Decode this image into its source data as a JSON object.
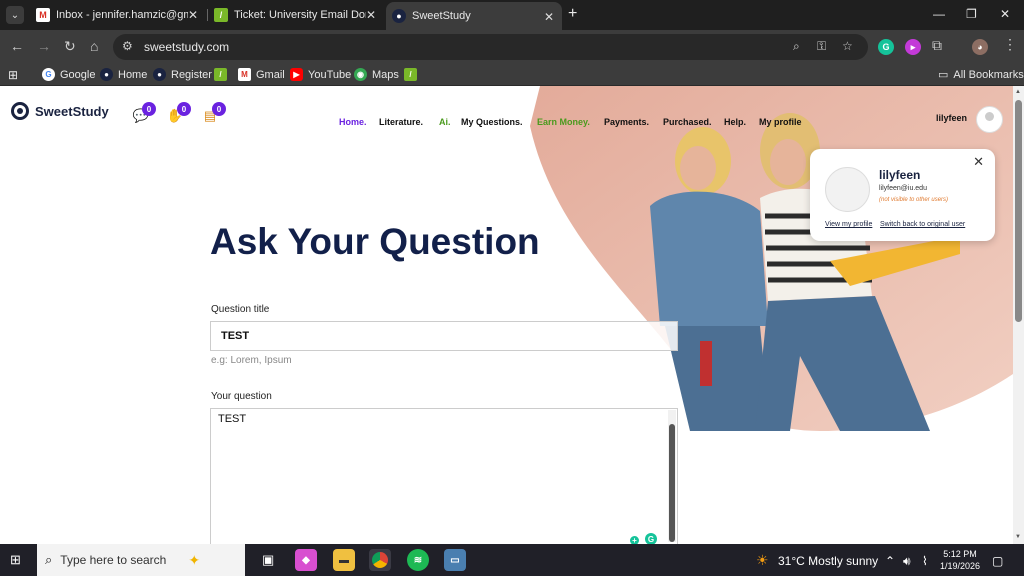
{
  "tabs": [
    {
      "title": "Inbox - jennifer.hamzic@gmail.",
      "favicon": "gmail-icon"
    },
    {
      "title": "Ticket: University Email Domain",
      "favicon": "ticket-icon"
    },
    {
      "title": "SweetStudy",
      "favicon": "sweetstudy-icon",
      "active": true
    }
  ],
  "address_bar": {
    "url": "sweetstudy.com"
  },
  "bookmarks": {
    "items": [
      {
        "label": "Google",
        "icon": "google-icon"
      },
      {
        "label": "Home",
        "icon": "home-site-icon"
      },
      {
        "label": "Register",
        "icon": "register-site-icon"
      },
      {
        "label": "",
        "icon": "feather-icon"
      },
      {
        "label": "Gmail",
        "icon": "gmail-icon"
      },
      {
        "label": "YouTube",
        "icon": "youtube-icon"
      },
      {
        "label": "Maps",
        "icon": "maps-icon"
      },
      {
        "label": "",
        "icon": "feather-icon"
      }
    ],
    "all_bookmarks": "All Bookmarks"
  },
  "site": {
    "logo": "SweetStudy",
    "badges": [
      "0",
      "0",
      "0"
    ],
    "menu": [
      "Home.",
      "Literature.",
      "Ai.",
      "My Questions.",
      "Earn Money.",
      "Payments.",
      "Purchased.",
      "Help.",
      "My profile"
    ],
    "username": "lilyfeen"
  },
  "popup": {
    "name": "lilyfeen",
    "email": "lilyfeen@iu.edu",
    "note": "(not visible to other users)",
    "view_profile": "View my profile",
    "switch_back": "Switch back to original user"
  },
  "form": {
    "heading": "Ask Your Question",
    "title_label": "Question title",
    "title_value": "TEST",
    "title_hint": "e.g: Lorem, Ipsum",
    "question_label": "Your question",
    "question_value": "TEST"
  },
  "taskbar": {
    "search_placeholder": "Type here to search",
    "weather": "31°C  Mostly sunny",
    "time": "5:12 PM",
    "date": "1/19/2026"
  },
  "colors": {
    "accent": "#6a22e0",
    "earn": "#4a9a1d",
    "heading": "#12204a",
    "hero_bg": "#e8b6a6"
  }
}
